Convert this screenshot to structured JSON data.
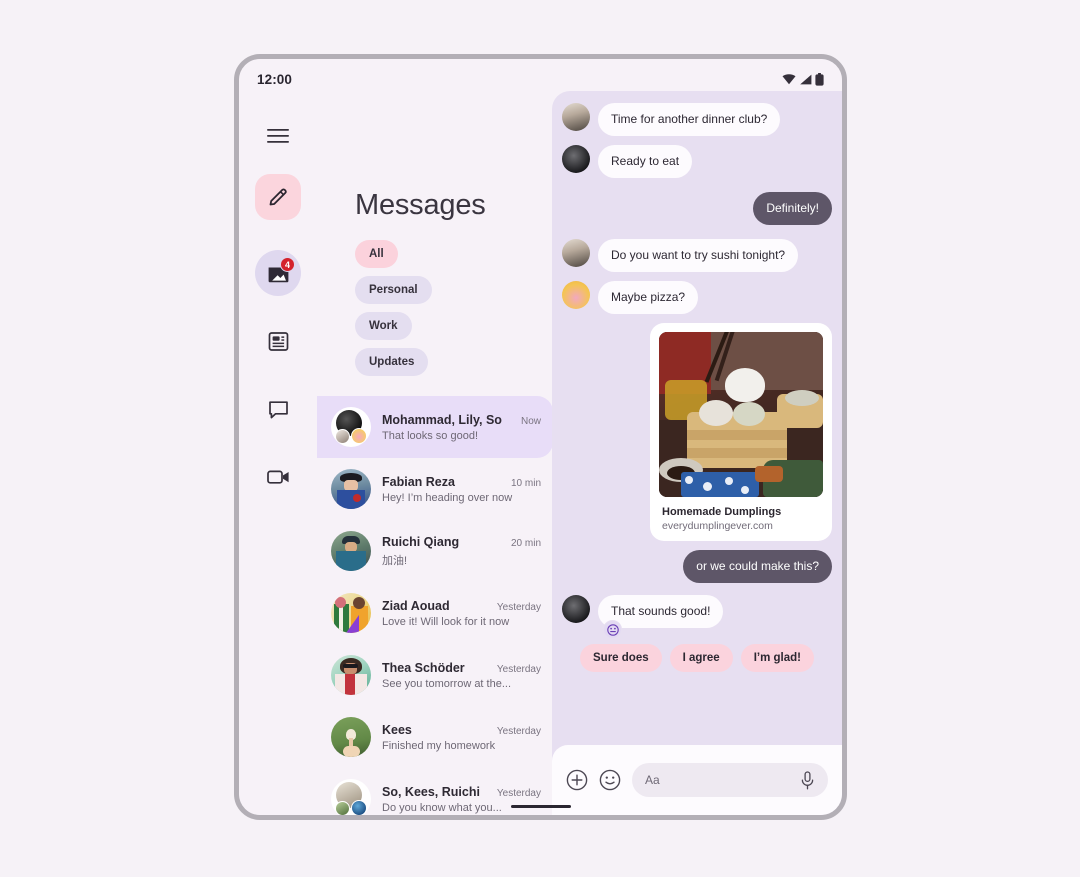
{
  "status_bar": {
    "time": "12:00",
    "icons": [
      "wifi-icon",
      "cellular-signal-icon",
      "battery-icon"
    ]
  },
  "nav_rail": {
    "items": [
      {
        "icon": "hamburger-menu-icon",
        "name": "menu"
      },
      {
        "icon": "pencil-compose-icon",
        "name": "compose"
      },
      {
        "icon": "inbox-icon",
        "name": "inbox",
        "badge": "4"
      },
      {
        "icon": "article-list-icon",
        "name": "feed"
      },
      {
        "icon": "chat-bubble-icon",
        "name": "chats"
      },
      {
        "icon": "video-camera-icon",
        "name": "video"
      }
    ]
  },
  "list_panel": {
    "title": "Messages",
    "chips": [
      {
        "label": "All",
        "selected": true
      },
      {
        "label": "Personal",
        "selected": false
      },
      {
        "label": "Work",
        "selected": false
      },
      {
        "label": "Updates",
        "selected": false
      }
    ],
    "threads": [
      {
        "name": "Mohammad, Lily, So",
        "time": "Now",
        "snippet": "That looks so good!",
        "active": true,
        "avatar": "group-avatar"
      },
      {
        "name": "Fabian Reza",
        "time": "10 min",
        "snippet": "Hey! I’m heading over now",
        "active": false,
        "avatar": "person-cowboy-hat"
      },
      {
        "name": "Ruichi Qiang",
        "time": "20 min",
        "snippet": "加油!",
        "active": false,
        "avatar": "person-cap-street"
      },
      {
        "name": "Ziad Aouad",
        "time": "Yesterday",
        "snippet": "Love it! Will look for it now",
        "active": false,
        "avatar": "two-people-colorful"
      },
      {
        "name": "Thea Schöder",
        "time": "Yesterday",
        "snippet": "See you tomorrow at the...",
        "active": false,
        "avatar": "person-sunglasses"
      },
      {
        "name": "Kees",
        "time": "Yesterday",
        "snippet": "Finished my homework",
        "active": false,
        "avatar": "hand-flower-grass"
      },
      {
        "name": "So, Kees, Ruichi",
        "time": "Yesterday",
        "snippet": "Do you know what you...",
        "active": false,
        "avatar": "group-avatar-2"
      }
    ]
  },
  "chat": {
    "messages": [
      {
        "id": "m1",
        "text": "Time for another dinner club?",
        "direction": "in",
        "avatar": "person-portrait"
      },
      {
        "id": "m2",
        "text": "Ready to eat",
        "direction": "in",
        "avatar": "person-silhouette"
      },
      {
        "id": "m3",
        "text": "Definitely!",
        "direction": "out"
      },
      {
        "id": "m4",
        "text": "Do you want to try sushi tonight?",
        "direction": "in",
        "avatar": "person-portrait"
      },
      {
        "id": "m5",
        "text": "Maybe pizza?",
        "direction": "in",
        "avatar": "flower-bouquet"
      },
      {
        "id": "m7",
        "text": "or we could make this?",
        "direction": "out"
      },
      {
        "id": "m8",
        "text": "That sounds good!",
        "direction": "in",
        "avatar": "person-silhouette",
        "reaction": "😊"
      }
    ],
    "link_card": {
      "title": "Homemade Dumplings",
      "url": "everydumplingever.com",
      "image_alt": "dumpling-in-bamboo-steamer-photo"
    },
    "quick_replies": [
      "Sure does",
      "I agree",
      "I’m glad!"
    ],
    "composer": {
      "placeholder": "Aa",
      "value": "",
      "add_icon": "plus-circle-icon",
      "emoji_icon": "emoji-smiley-icon",
      "mic_icon": "microphone-icon"
    }
  },
  "colors": {
    "page_background": "#f6f2f7",
    "screen_background": "#f7f2f8",
    "chat_background": "#e7dff1",
    "accent_pink": "#fbd3dd",
    "accent_lavender": "#e4def0",
    "active_thread": "#e8ddf8",
    "outgoing_bubble": "#5e5668",
    "incoming_bubble": "#fdfbfe",
    "badge_red": "#d4222c",
    "device_frame": "#b3afb6"
  }
}
